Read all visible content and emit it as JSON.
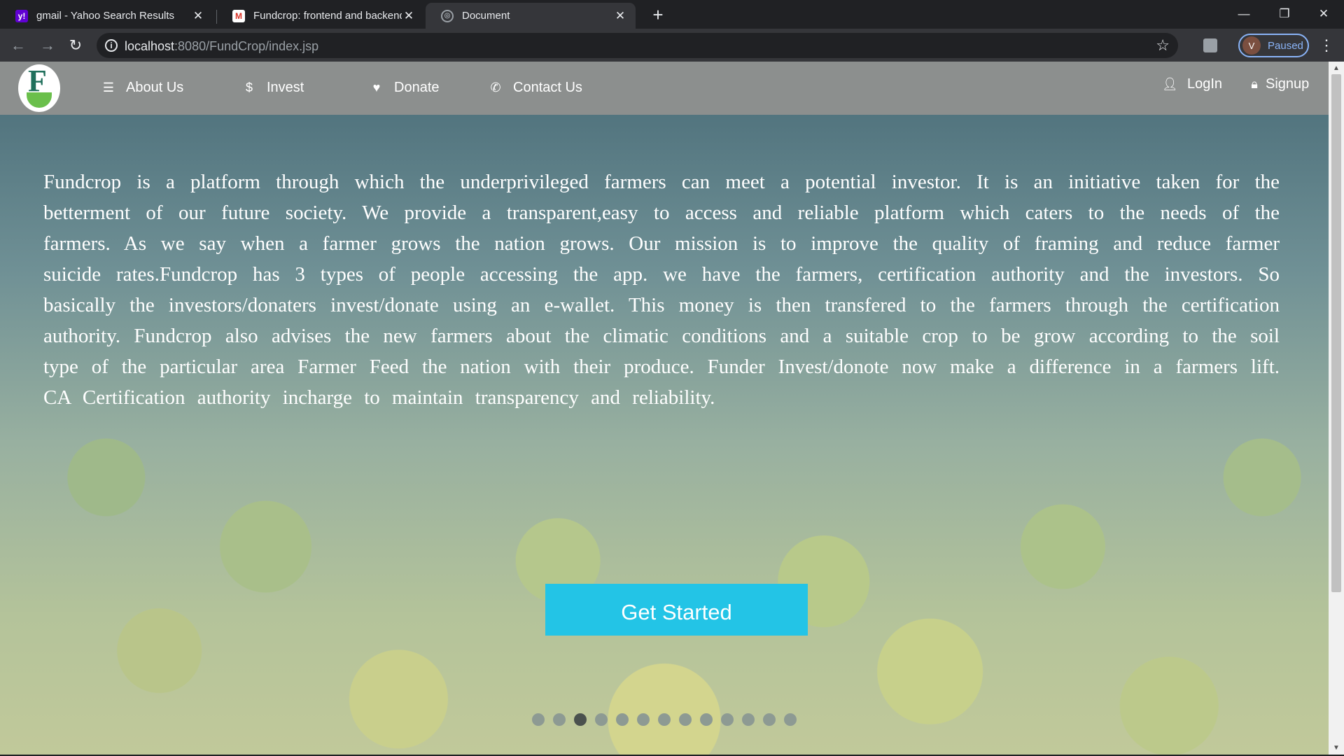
{
  "browser": {
    "tabs": [
      {
        "title": "gmail - Yahoo Search Results",
        "favicon": "yahoo-icon"
      },
      {
        "title": "Fundcrop: frontend and backend",
        "favicon": "gmail-icon"
      },
      {
        "title": "Document",
        "favicon": "globe-icon",
        "active": true
      }
    ],
    "url_host": "localhost",
    "url_path": ":8080/FundCrop/index.jsp",
    "profile_initial": "V",
    "profile_status": "Paused"
  },
  "navbar": {
    "items": [
      {
        "label": "About Us",
        "icon": "menu-icon"
      },
      {
        "label": "Invest",
        "icon": "dollar-icon"
      },
      {
        "label": "Donate",
        "icon": "heart-icon"
      },
      {
        "label": "Contact Us",
        "icon": "phone-icon"
      }
    ],
    "login": "LogIn",
    "signup": "Signup"
  },
  "hero": {
    "about_text": "Fundcrop is a platform through which the underprivileged farmers can meet a potential investor. It is an initiative taken for the betterment of our future society. We provide a transparent,easy to access and reliable platform which caters to the needs of the farmers. As we say when a farmer grows the nation grows. Our mission is to improve the quality of framing and reduce farmer suicide rates.Fundcrop has 3 types of people accessing the app. we have the farmers, certification authority and the investors. So basically the investors/donaters invest/donate using an e-wallet. This money is then transfered to the farmers through the certification authority. Fundcrop also advises the new farmers about the climatic conditions and a suitable crop to be grow according to the soil type of the particular area Farmer Feed the nation with their produce. Funder Invest/donote now make a difference in a farmers lift. CA Certification authority incharge to maintain transparency and reliability.",
    "cta": "Get Started",
    "carousel_total": 13,
    "carousel_active": 3
  },
  "colors": {
    "cta": "#23c4e6",
    "navbar": "#8c8f8e"
  }
}
